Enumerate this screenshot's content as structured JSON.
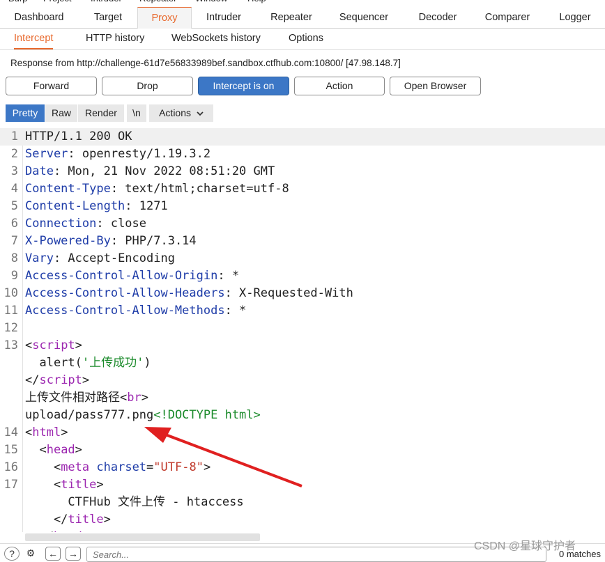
{
  "menubar": [
    "Burp",
    "Project",
    "Intruder",
    "Repeater",
    "Window",
    "Help"
  ],
  "tabs": [
    "Dashboard",
    "Target",
    "Proxy",
    "Intruder",
    "Repeater",
    "Sequencer",
    "Decoder",
    "Comparer",
    "Logger"
  ],
  "active_tab": "Proxy",
  "subtabs": [
    "Intercept",
    "HTTP history",
    "WebSockets history",
    "Options"
  ],
  "active_subtab": "Intercept",
  "response_line": "Response from http://challenge-61d7e56833989bef.sandbox.ctfhub.com:10800/  [47.98.148.7]",
  "buttons": {
    "forward": "Forward",
    "drop": "Drop",
    "intercept": "Intercept is on",
    "action": "Action",
    "open_browser": "Open Browser"
  },
  "view_tabs": {
    "pretty": "Pretty",
    "raw": "Raw",
    "render": "Render",
    "newline": "\\n",
    "actions": "Actions"
  },
  "lines": [
    {
      "n": "1",
      "parts": [
        {
          "c": "v",
          "t": "HTTP/1.1 200 OK"
        }
      ]
    },
    {
      "n": "2",
      "parts": [
        {
          "c": "k",
          "t": "Server"
        },
        {
          "c": "v",
          "t": ": openresty/1.19.3.2"
        }
      ]
    },
    {
      "n": "3",
      "parts": [
        {
          "c": "k",
          "t": "Date"
        },
        {
          "c": "v",
          "t": ": Mon, 21 Nov 2022 08:51:20 GMT"
        }
      ]
    },
    {
      "n": "4",
      "parts": [
        {
          "c": "k",
          "t": "Content-Type"
        },
        {
          "c": "v",
          "t": ": text/html;charset=utf-8"
        }
      ]
    },
    {
      "n": "5",
      "parts": [
        {
          "c": "k",
          "t": "Content-Length"
        },
        {
          "c": "v",
          "t": ": 1271"
        }
      ]
    },
    {
      "n": "6",
      "parts": [
        {
          "c": "k",
          "t": "Connection"
        },
        {
          "c": "v",
          "t": ": close"
        }
      ]
    },
    {
      "n": "7",
      "parts": [
        {
          "c": "k",
          "t": "X-Powered-By"
        },
        {
          "c": "v",
          "t": ": PHP/7.3.14"
        }
      ]
    },
    {
      "n": "8",
      "parts": [
        {
          "c": "k",
          "t": "Vary"
        },
        {
          "c": "v",
          "t": ": Accept-Encoding"
        }
      ]
    },
    {
      "n": "9",
      "parts": [
        {
          "c": "k",
          "t": "Access-Control-Allow-Origin"
        },
        {
          "c": "v",
          "t": ": *"
        }
      ]
    },
    {
      "n": "10",
      "parts": [
        {
          "c": "k",
          "t": "Access-Control-Allow-Headers"
        },
        {
          "c": "v",
          "t": ": X-Requested-With"
        }
      ]
    },
    {
      "n": "11",
      "parts": [
        {
          "c": "k",
          "t": "Access-Control-Allow-Methods"
        },
        {
          "c": "v",
          "t": ": *"
        }
      ]
    },
    {
      "n": "12",
      "parts": []
    },
    {
      "n": "13",
      "parts": [
        {
          "c": "v",
          "t": "<"
        },
        {
          "c": "t",
          "t": "script"
        },
        {
          "c": "v",
          "t": ">"
        }
      ]
    },
    {
      "n": "",
      "parts": [
        {
          "c": "v",
          "t": "  alert("
        },
        {
          "c": "g",
          "t": "'上传成功'"
        },
        {
          "c": "v",
          "t": ")"
        }
      ]
    },
    {
      "n": "",
      "parts": [
        {
          "c": "v",
          "t": "</"
        },
        {
          "c": "t",
          "t": "script"
        },
        {
          "c": "v",
          "t": ">"
        }
      ]
    },
    {
      "n": "",
      "parts": [
        {
          "c": "v",
          "t": "上传文件相对路径<"
        },
        {
          "c": "t",
          "t": "br"
        },
        {
          "c": "v",
          "t": ">"
        }
      ]
    },
    {
      "n": "",
      "parts": [
        {
          "c": "v",
          "t": "upload/pass777.png"
        },
        {
          "c": "g",
          "t": "<!DOCTYPE html>"
        }
      ]
    },
    {
      "n": "14",
      "parts": [
        {
          "c": "v",
          "t": "<"
        },
        {
          "c": "t",
          "t": "html"
        },
        {
          "c": "v",
          "t": ">"
        }
      ]
    },
    {
      "n": "15",
      "parts": [
        {
          "c": "v",
          "t": "  <"
        },
        {
          "c": "t",
          "t": "head"
        },
        {
          "c": "v",
          "t": ">"
        }
      ]
    },
    {
      "n": "16",
      "parts": [
        {
          "c": "v",
          "t": "    <"
        },
        {
          "c": "t",
          "t": "meta"
        },
        {
          "c": "v",
          "t": " "
        },
        {
          "c": "k",
          "t": "charset"
        },
        {
          "c": "v",
          "t": "="
        },
        {
          "c": "s",
          "t": "\"UTF-8\""
        },
        {
          "c": "v",
          "t": ">"
        }
      ]
    },
    {
      "n": "17",
      "parts": [
        {
          "c": "v",
          "t": "    <"
        },
        {
          "c": "t",
          "t": "title"
        },
        {
          "c": "v",
          "t": ">"
        }
      ]
    },
    {
      "n": "",
      "parts": [
        {
          "c": "v",
          "t": "      CTFHub 文件上传 - htaccess"
        }
      ]
    },
    {
      "n": "",
      "parts": [
        {
          "c": "v",
          "t": "    </"
        },
        {
          "c": "t",
          "t": "title"
        },
        {
          "c": "v",
          "t": ">"
        }
      ]
    },
    {
      "n": "",
      "parts": [
        {
          "c": "v",
          "t": "  </"
        },
        {
          "c": "t",
          "t": "head"
        },
        {
          "c": "v",
          "t": ">"
        }
      ]
    }
  ],
  "bottom": {
    "search_placeholder": "Search...",
    "matches": "0 matches"
  },
  "watermark": "CSDN @星球守护者",
  "colors": {
    "accent": "#e8692d",
    "button_on": "#3c77c6",
    "arrow": "#e02020"
  }
}
